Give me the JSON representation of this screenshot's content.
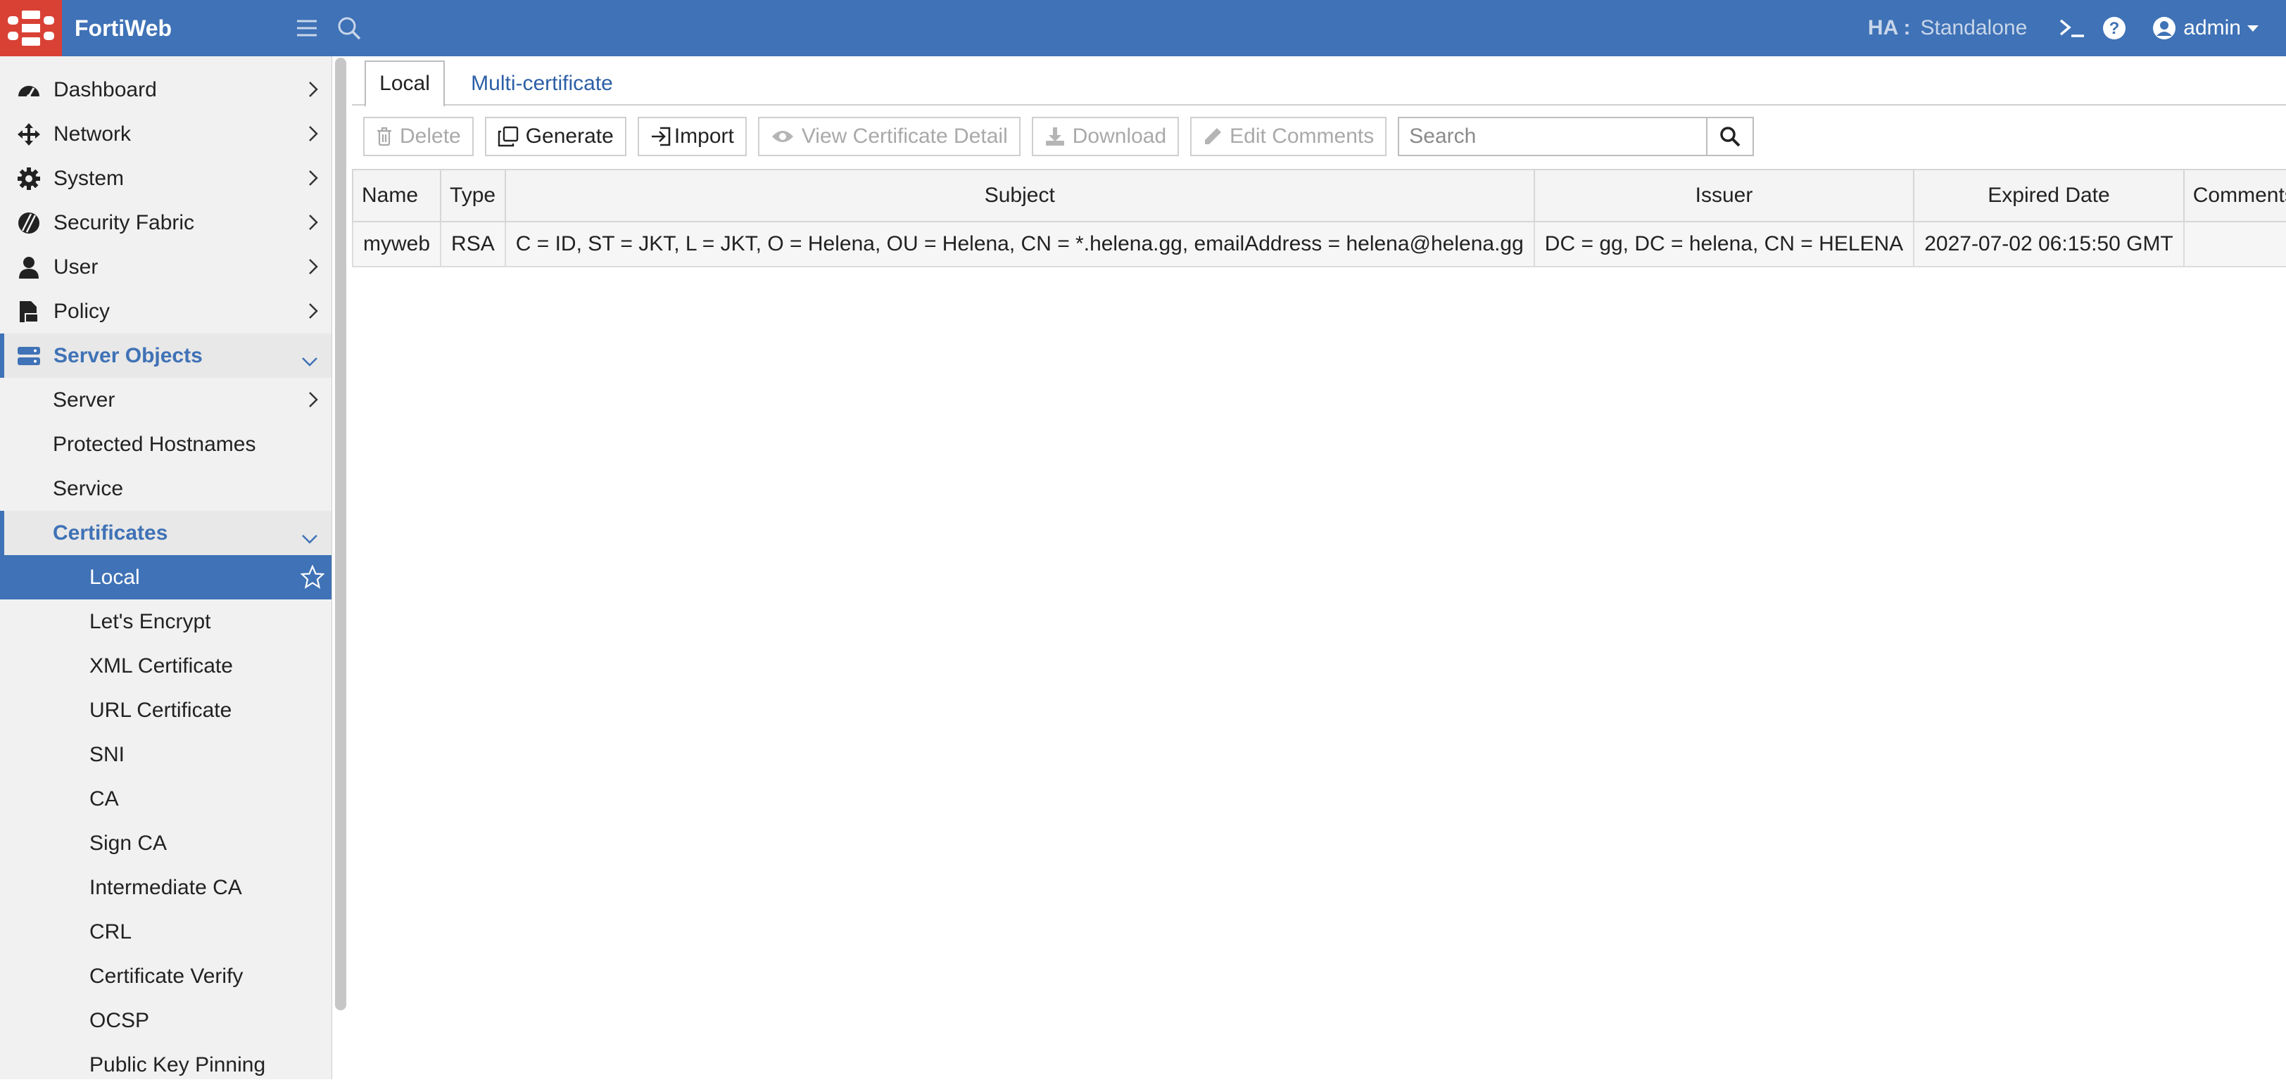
{
  "topbar": {
    "brand": "FortiWeb",
    "ha_label": "HA :",
    "ha_value": "Standalone",
    "user": "admin"
  },
  "sidebar": {
    "items": [
      {
        "label": "Dashboard",
        "icon": "dashboard-icon"
      },
      {
        "label": "Network",
        "icon": "network-icon"
      },
      {
        "label": "System",
        "icon": "gear-icon"
      },
      {
        "label": "Security Fabric",
        "icon": "security-fabric-icon"
      },
      {
        "label": "User",
        "icon": "user-icon"
      },
      {
        "label": "Policy",
        "icon": "policy-icon"
      },
      {
        "label": "Server Objects",
        "icon": "server-icon"
      }
    ],
    "server_objects_children": [
      "Server",
      "Protected Hostnames",
      "Service",
      "Certificates"
    ],
    "certificate_children": [
      "Local",
      "Let's Encrypt",
      "XML Certificate",
      "URL Certificate",
      "SNI",
      "CA",
      "Sign CA",
      "Intermediate CA",
      "CRL",
      "Certificate Verify",
      "OCSP",
      "Public Key Pinning"
    ]
  },
  "tabs": [
    "Local",
    "Multi-certificate"
  ],
  "toolbar": {
    "delete": "Delete",
    "generate": "Generate",
    "import": "Import",
    "view_detail": "View Certificate Detail",
    "download": "Download",
    "edit_comments": "Edit Comments",
    "search_placeholder": "Search"
  },
  "table": {
    "columns": [
      "Name",
      "Type",
      "Subject",
      "Issuer",
      "Expired Date",
      "Comments"
    ],
    "rows": [
      [
        "myweb",
        "RSA",
        "C = ID, ST = JKT, L = JKT, O = Helena, OU = Helena, CN = *.helena.gg, emailAddress = helena@helena.gg",
        "DC = gg, DC = helena, CN = HELENA",
        "2027-07-02 06:15:50 GMT",
        ""
      ]
    ]
  },
  "colors": {
    "accent": "#3f72b6",
    "logo": "#d94135"
  }
}
